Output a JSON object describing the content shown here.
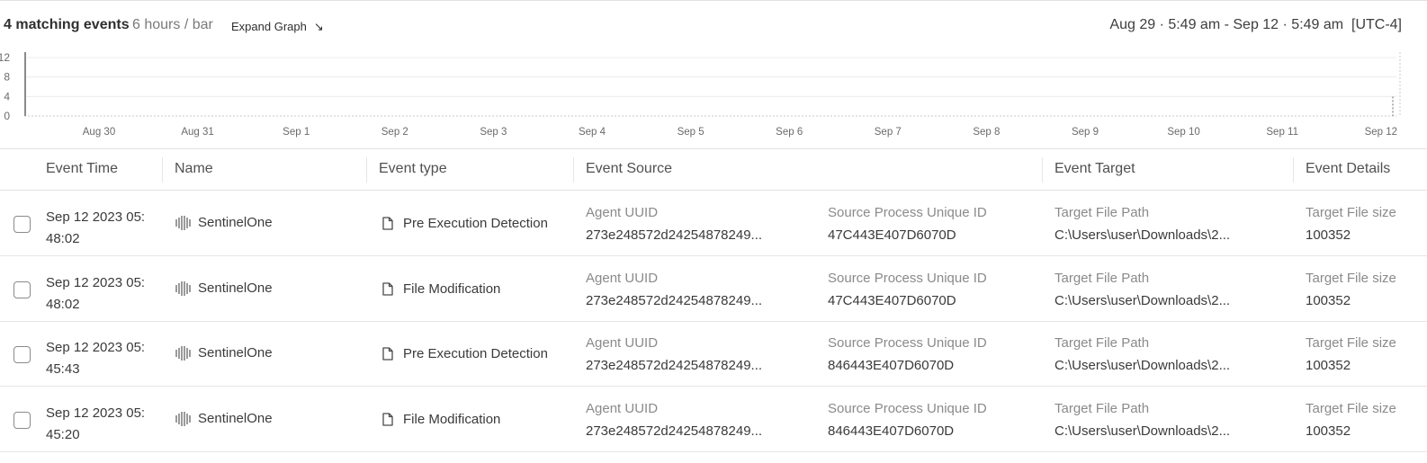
{
  "header": {
    "count": "4 matching events",
    "interval": "6 hours / bar",
    "expand_label": "Expand Graph",
    "expand_icon": "arrow-down-right-icon",
    "date_range": "Aug 29 · 5:49 am - Sep 12 · 5:49 am",
    "timezone": "[UTC-4]"
  },
  "chart_data": {
    "type": "bar",
    "ylim": [
      0,
      12
    ],
    "y_ticks": [
      "12",
      "8",
      "4",
      "0"
    ],
    "x_ticks": [
      "Aug 30",
      "Aug 31",
      "Sep 1",
      "Sep 2",
      "Sep 3",
      "Sep 4",
      "Sep 5",
      "Sep 6",
      "Sep 7",
      "Sep 8",
      "Sep 9",
      "Sep 10",
      "Sep 11",
      "Sep 12"
    ],
    "grid": true,
    "bars": [
      {
        "x": "Sep 12 · 05:45",
        "value": 4
      }
    ],
    "colors": {
      "bar": "#9a9a9a",
      "axis_start": "#8a8a8a",
      "grid": "#c8c8c8"
    }
  },
  "table": {
    "columns": [
      "Event Time",
      "Name",
      "Event type",
      "Event Source",
      "Event Target",
      "Event Details"
    ],
    "rows": [
      {
        "time_line1": "Sep 12 2023 05:",
        "time_line2": "48:02",
        "name": "SentinelOne",
        "name_icon": "sentinelone-icon",
        "event_type": "Pre Execution Detection",
        "event_type_icon": "file-icon",
        "agent_uuid_label": "Agent UUID",
        "agent_uuid": "273e248572d24254878249...",
        "src_proc_label": "Source Process Unique ID",
        "src_proc": "47C443E407D6070D",
        "target_label": "Target File Path",
        "target": "C:\\Users\\user\\Downloads\\2...",
        "details_label": "Target File size",
        "details": "100352"
      },
      {
        "time_line1": "Sep 12 2023 05:",
        "time_line2": "48:02",
        "name": "SentinelOne",
        "name_icon": "sentinelone-icon",
        "event_type": "File Modification",
        "event_type_icon": "file-icon",
        "agent_uuid_label": "Agent UUID",
        "agent_uuid": "273e248572d24254878249...",
        "src_proc_label": "Source Process Unique ID",
        "src_proc": "47C443E407D6070D",
        "target_label": "Target File Path",
        "target": "C:\\Users\\user\\Downloads\\2...",
        "details_label": "Target File size",
        "details": "100352"
      },
      {
        "time_line1": "Sep 12 2023 05:",
        "time_line2": "45:43",
        "name": "SentinelOne",
        "name_icon": "sentinelone-icon",
        "event_type": "Pre Execution Detection",
        "event_type_icon": "file-icon",
        "agent_uuid_label": "Agent UUID",
        "agent_uuid": "273e248572d24254878249...",
        "src_proc_label": "Source Process Unique ID",
        "src_proc": "846443E407D6070D",
        "target_label": "Target File Path",
        "target": "C:\\Users\\user\\Downloads\\2...",
        "details_label": "Target File size",
        "details": "100352"
      },
      {
        "time_line1": "Sep 12 2023 05:",
        "time_line2": "45:20",
        "name": "SentinelOne",
        "name_icon": "sentinelone-icon",
        "event_type": "File Modification",
        "event_type_icon": "file-icon",
        "agent_uuid_label": "Agent UUID",
        "agent_uuid": "273e248572d24254878249...",
        "src_proc_label": "Source Process Unique ID",
        "src_proc": "846443E407D6070D",
        "target_label": "Target File Path",
        "target": "C:\\Users\\user\\Downloads\\2...",
        "details_label": "Target File size",
        "details": "100352"
      }
    ]
  }
}
